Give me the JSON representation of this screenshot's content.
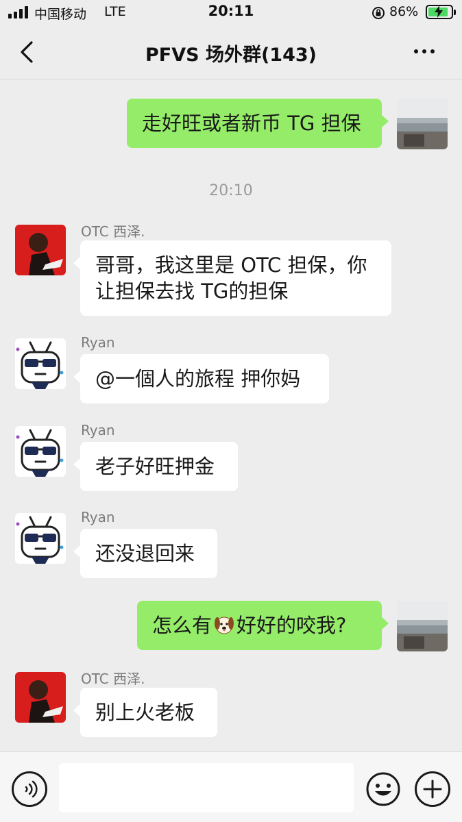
{
  "status_bar": {
    "carrier": "中国移动",
    "network": "LTE",
    "time": "20:11",
    "battery_percent": "86%",
    "battery_level": 0.86
  },
  "nav": {
    "title": "PFVS 场外群(143)",
    "back_icon": "chevron-left-icon",
    "more_icon": "ellipsis-icon"
  },
  "messages": [
    {
      "direction": "out",
      "text": "走好旺或者新币 TG 担保"
    },
    {
      "timestamp": "20:10"
    },
    {
      "direction": "in",
      "sender": "OTC 西泽.",
      "line1": "哥哥，我这里是 OTC 担保，你",
      "line2": "让担保去找 TG的担保"
    },
    {
      "direction": "in",
      "sender": "Ryan",
      "text": "@一個人的旅程 押你妈"
    },
    {
      "direction": "in",
      "sender": "Ryan",
      "text": "老子好旺押金"
    },
    {
      "direction": "in",
      "sender": "Ryan",
      "text": "还没退回来"
    },
    {
      "direction": "out",
      "text_before": "怎么有",
      "emoji": "dog-face-icon",
      "text_after": "好好的咬我?"
    },
    {
      "direction": "in",
      "sender": "OTC 西泽.",
      "text": "别上火老板"
    }
  ],
  "input_bar": {
    "voice_icon": "voice-icon",
    "emoji_icon": "smiley-icon",
    "plus_icon": "plus-icon"
  },
  "colors": {
    "background": "#ededed",
    "outgoing_bubble": "#95ec69",
    "incoming_bubble": "#ffffff",
    "battery_fill": "#4cd964"
  }
}
